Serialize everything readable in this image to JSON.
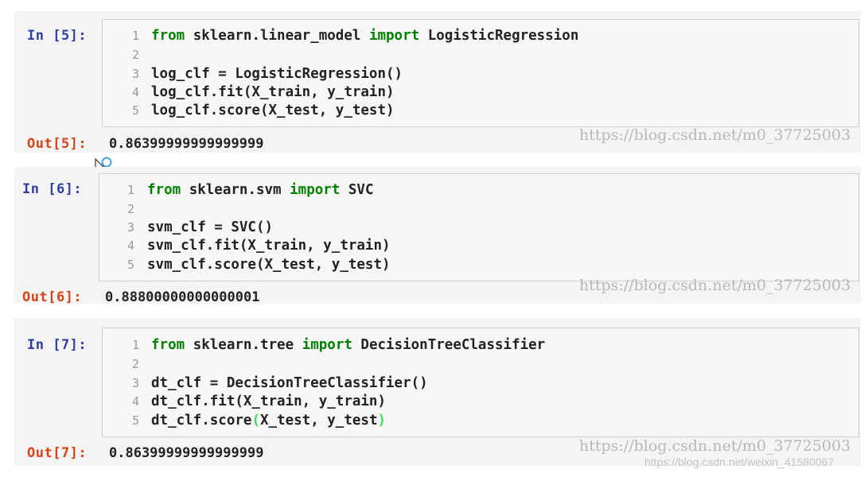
{
  "cells": [
    {
      "in_prompt": "In [5]:",
      "out_prompt": "Out[5]:",
      "output": "0.86399999999999999",
      "lines": [
        {
          "num": "1",
          "kw1": "from",
          "mid": " sklearn.linear_model ",
          "kw2": "import",
          "rest": " LogisticRegression"
        },
        {
          "num": "2",
          "text": ""
        },
        {
          "num": "3",
          "text": "log_clf = LogisticRegression()"
        },
        {
          "num": "4",
          "text": "log_clf.fit(X_train, y_train)"
        },
        {
          "num": "5",
          "text": "log_clf.score(X_test, y_test)"
        }
      ]
    },
    {
      "in_prompt": "In [6]:",
      "out_prompt": "Out[6]:",
      "output": "0.88800000000000001",
      "lines": [
        {
          "num": "1",
          "kw1": "from",
          "mid": " sklearn.svm ",
          "kw2": "import",
          "rest": " SVC"
        },
        {
          "num": "2",
          "text": ""
        },
        {
          "num": "3",
          "text": "svm_clf = SVC()"
        },
        {
          "num": "4",
          "text": "svm_clf.fit(X_train, y_train)"
        },
        {
          "num": "5",
          "text": "svm_clf.score(X_test, y_test)"
        }
      ]
    },
    {
      "in_prompt": "In [7]:",
      "out_prompt": "Out[7]:",
      "output": "0.86399999999999999",
      "lines": [
        {
          "num": "1",
          "kw1": "from",
          "mid": " sklearn.tree ",
          "kw2": "import",
          "rest": " DecisionTreeClassifier"
        },
        {
          "num": "2",
          "text": ""
        },
        {
          "num": "3",
          "text": "dt_clf = DecisionTreeClassifier()"
        },
        {
          "num": "4",
          "text": "dt_clf.fit(X_train, y_train)"
        },
        {
          "num": "5",
          "pre": "dt_clf.score",
          "open": "(",
          "args": "X_test, y_test",
          "close": ")"
        }
      ]
    }
  ],
  "watermarks": {
    "main": "https://blog.csdn.net/m0_37725003",
    "footer": "https://blog.csdn.net/weixin_41580067"
  }
}
